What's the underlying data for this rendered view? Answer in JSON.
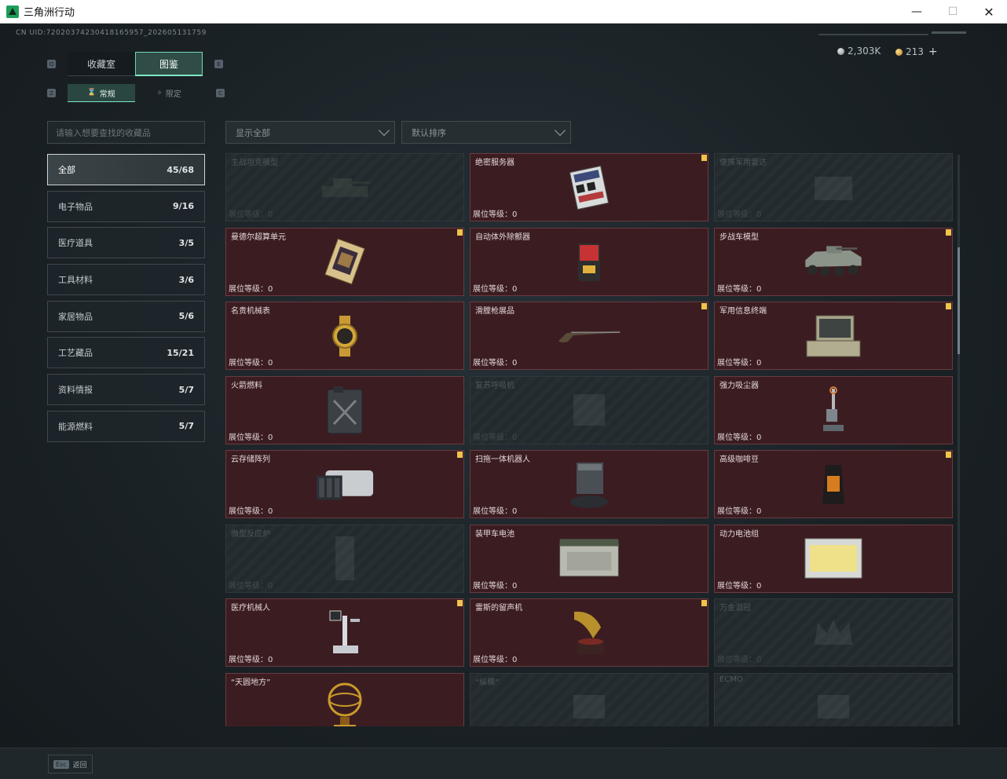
{
  "window": {
    "title": "三角洲行动",
    "min_glyph": "—",
    "max_glyph": "☐",
    "close_glyph": "✕"
  },
  "uid": "CN UID:7202037423041816​5957_202605131759",
  "currency": {
    "coins": "2,303K",
    "tokens": "213",
    "plus": "+"
  },
  "keyhints": {
    "q": "Q",
    "e": "E",
    "z": "Z",
    "c": "C"
  },
  "tabs": {
    "collection": "收藏室",
    "catalog": "图鉴"
  },
  "subtabs": {
    "normal": "常规",
    "limited": "限定"
  },
  "search_placeholder": "请输入想要查找的收藏品",
  "filter": "显示全部",
  "sort": "默认排序",
  "categories": [
    {
      "label": "全部",
      "count": "45/68"
    },
    {
      "label": "电子物品",
      "count": "9/16"
    },
    {
      "label": "医疗道具",
      "count": "3/5"
    },
    {
      "label": "工具材料",
      "count": "3/6"
    },
    {
      "label": "家居物品",
      "count": "5/6"
    },
    {
      "label": "工艺藏品",
      "count": "15/21"
    },
    {
      "label": "资料情报",
      "count": "5/7"
    },
    {
      "label": "能源燃料",
      "count": "5/7"
    }
  ],
  "items": [
    {
      "name": "主战坦克模型",
      "level": "展位等级：0",
      "locked": true,
      "flag": false,
      "icon": "tank-icon"
    },
    {
      "name": "绝密服务器",
      "level": "展位等级：0",
      "locked": false,
      "flag": true,
      "icon": "server-icon"
    },
    {
      "name": "便携军用雷达",
      "level": "展位等级：0",
      "locked": true,
      "flag": false,
      "icon": "radar-icon"
    },
    {
      "name": "曼德尔超算单元",
      "level": "展位等级：0",
      "locked": false,
      "flag": true,
      "icon": "cpu-icon"
    },
    {
      "name": "自动体外除颤器",
      "level": "展位等级：0",
      "locked": false,
      "flag": false,
      "icon": "defibrillator-icon"
    },
    {
      "name": "步战车模型",
      "level": "展位等级：0",
      "locked": false,
      "flag": true,
      "icon": "ifv-icon"
    },
    {
      "name": "名贵机械表",
      "level": "展位等级：0",
      "locked": false,
      "flag": false,
      "icon": "watch-icon"
    },
    {
      "name": "滑膛枪展品",
      "level": "展位等级：0",
      "locked": false,
      "flag": true,
      "icon": "musket-icon"
    },
    {
      "name": "军用信息终端",
      "level": "展位等级：0",
      "locked": false,
      "flag": true,
      "icon": "terminal-icon"
    },
    {
      "name": "火箭燃料",
      "level": "展位等级：0",
      "locked": false,
      "flag": false,
      "icon": "fuel-can-icon"
    },
    {
      "name": "复苏呼吸机",
      "level": "展位等级：0",
      "locked": true,
      "flag": false,
      "icon": "ventilator-icon"
    },
    {
      "name": "强力吸尘器",
      "level": "展位等级：0",
      "locked": false,
      "flag": false,
      "icon": "vacuum-icon"
    },
    {
      "name": "云存储阵列",
      "level": "展位等级：0",
      "locked": false,
      "flag": true,
      "icon": "storage-array-icon"
    },
    {
      "name": "扫拖一体机器人",
      "level": "展位等级：0",
      "locked": false,
      "flag": false,
      "icon": "robot-vacuum-icon"
    },
    {
      "name": "高级咖啡豆",
      "level": "展位等级：0",
      "locked": false,
      "flag": true,
      "icon": "coffee-bag-icon"
    },
    {
      "name": "微型反应炉",
      "level": "展位等级：0",
      "locked": true,
      "flag": false,
      "icon": "reactor-icon"
    },
    {
      "name": "装甲车电池",
      "level": "展位等级：0",
      "locked": false,
      "flag": false,
      "icon": "battery-icon"
    },
    {
      "name": "动力电池组",
      "level": "展位等级：0",
      "locked": false,
      "flag": false,
      "icon": "battery-pack-icon"
    },
    {
      "name": "医疗机械人",
      "level": "展位等级：0",
      "locked": false,
      "flag": true,
      "icon": "medical-robot-icon"
    },
    {
      "name": "雷斯的留声机",
      "level": "展位等级：0",
      "locked": false,
      "flag": true,
      "icon": "gramophone-icon"
    },
    {
      "name": "万金泪冠",
      "level": "展位等级：0",
      "locked": true,
      "flag": false,
      "icon": "crown-icon"
    },
    {
      "name": "“天圆地方”",
      "level": "",
      "locked": false,
      "flag": false,
      "icon": "armillary-icon"
    },
    {
      "name": "“纵横”",
      "level": "",
      "locked": true,
      "flag": false,
      "icon": "sculpture-icon"
    },
    {
      "name": "ECMO",
      "level": "",
      "locked": true,
      "flag": false,
      "icon": "ecmo-icon"
    }
  ],
  "footer": {
    "esc": "Esc",
    "back": "返回"
  },
  "colors": {
    "accent": "#7fe6c1",
    "owned_bg": "#3b1d21",
    "flag": "#f0c44a"
  }
}
